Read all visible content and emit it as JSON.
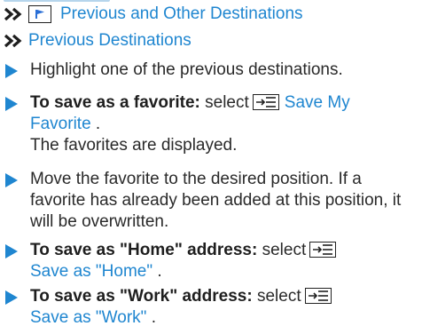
{
  "nav": {
    "line1_label": "Previous and Other Destinations",
    "line2_label": "Previous Destinations"
  },
  "steps": [
    {
      "text": "Highlight one of the previous destinations."
    },
    {
      "bold": "To save as a favorite:",
      "pre": "select",
      "link": "Save My Favorite",
      "after": ".",
      "result": "The favorites are displayed."
    },
    {
      "text": "Move the favorite to the desired position. If a favorite has already been added at this position, it will be overwritten."
    },
    {
      "bold": "To save as \"Home\" address:",
      "pre": "select",
      "link": "Save as \"Home\"",
      "after": "."
    },
    {
      "bold": "To save as \"Work\" address:",
      "pre": "select",
      "link": "Save as \"Work\"",
      "after": "."
    }
  ],
  "colors": {
    "accent": "#1f86d0",
    "text": "#2a2a2a"
  },
  "icons": {
    "nav_arrow": "double-chevron-right-icon",
    "nav_flag": "flag-box-icon",
    "bullet": "play-triangle-icon",
    "menu": "menu-list-icon"
  }
}
